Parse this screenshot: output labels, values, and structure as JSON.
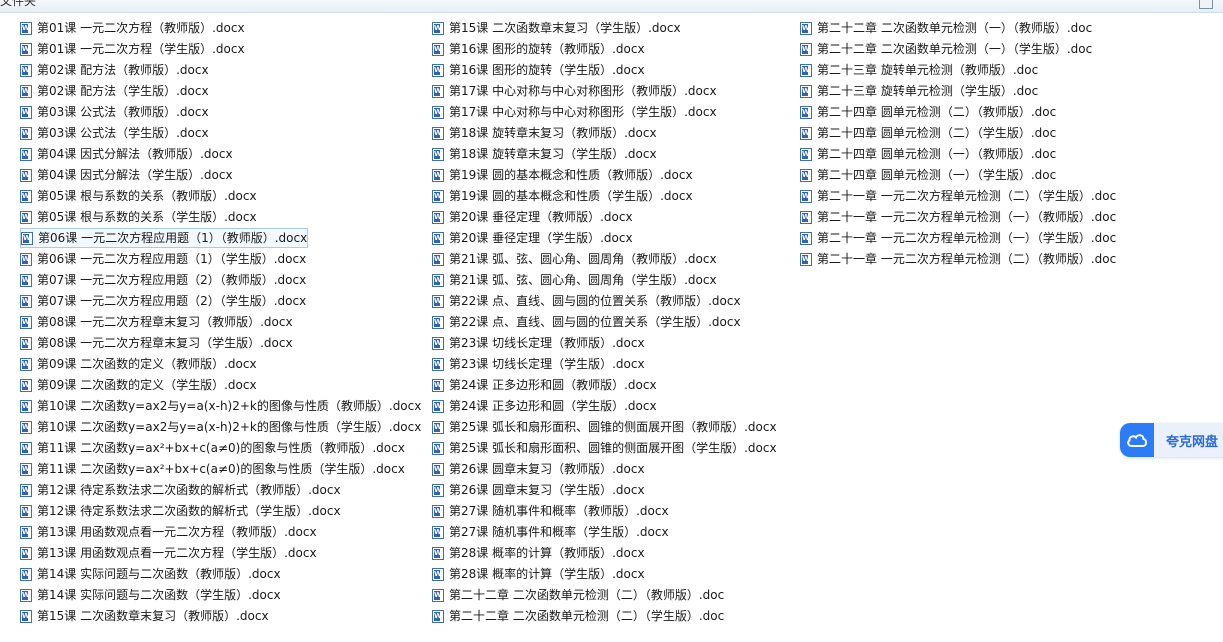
{
  "window": {
    "title": "文件夹"
  },
  "badge": {
    "label": "夸克网盘",
    "icon": "cloud-icon",
    "color": "#2b7cf6"
  },
  "columns": [
    [
      "第01课  一元二次方程（教师版）.docx",
      "第01课  一元二次方程（学生版）.docx",
      "第02课  配方法（教师版）.docx",
      "第02课  配方法（学生版）.docx",
      "第03课  公式法（教师版）.docx",
      "第03课  公式法（学生版）.docx",
      "第04课  因式分解法（教师版）.docx",
      "第04课  因式分解法（学生版）.docx",
      "第05课  根与系数的关系（教师版）.docx",
      "第05课  根与系数的关系（学生版）.docx",
      "第06课  一元二次方程应用题（1）（教师版）.docx",
      "第06课  一元二次方程应用题（1）（学生版）.docx",
      "第07课  一元二次方程应用题（2）（教师版）.docx",
      "第07课  一元二次方程应用题（2）（学生版）.docx",
      "第08课  一元二次方程章末复习（教师版）.docx",
      "第08课  一元二次方程章末复习（学生版）.docx",
      "第09课  二次函数的定义（教师版）.docx",
      "第09课  二次函数的定义（学生版）.docx",
      "第10课  二次函数y=ax2与y=a(x-h)2+k的图像与性质（教师版）.docx",
      "第10课  二次函数y=ax2与y=a(x-h)2+k的图像与性质（学生版）.docx",
      "第11课 二次函数y=ax²+bx+c(a≠0)的图象与性质（教师版）.docx",
      "第11课 二次函数y=ax²+bx+c(a≠0)的图象与性质（学生版）.docx",
      "第12课  待定系数法求二次函数的解析式（教师版）.docx",
      "第12课  待定系数法求二次函数的解析式（学生版）.docx",
      "第13课  用函数观点看一元二次方程（教师版）.docx",
      "第13课  用函数观点看一元二次方程（学生版）.docx",
      "第14课  实际问题与二次函数（教师版）.docx",
      "第14课  实际问题与二次函数（学生版）.docx",
      "第15课  二次函数章末复习（教师版）.docx"
    ],
    [
      "第15课  二次函数章末复习（学生版）.docx",
      "第16课  图形的旋转（教师版）.docx",
      "第16课  图形的旋转（学生版）.docx",
      "第17课  中心对称与中心对称图形（教师版）.docx",
      "第17课  中心对称与中心对称图形（学生版）.docx",
      "第18课  旋转章末复习（教师版）.docx",
      "第18课  旋转章末复习（学生版）.docx",
      "第19课  圆的基本概念和性质（教师版）.docx",
      "第19课  圆的基本概念和性质（学生版）.docx",
      "第20课  垂径定理（教师版）.docx",
      "第20课  垂径定理（学生版）.docx",
      "第21课  弧、弦、圆心角、圆周角（教师版）.docx",
      "第21课  弧、弦、圆心角、圆周角（学生版）.docx",
      "第22课  点、直线、圆与圆的位置关系（教师版）.docx",
      "第22课  点、直线、圆与圆的位置关系（学生版）.docx",
      "第23课  切线长定理（教师版）.docx",
      "第23课  切线长定理（学生版）.docx",
      "第24课  正多边形和圆（教师版）.docx",
      "第24课  正多边形和圆（学生版）.docx",
      "第25课  弧长和扇形面积、圆锥的侧面展开图（教师版）.docx",
      "第25课  弧长和扇形面积、圆锥的侧面展开图（学生版）.docx",
      "第26课  圆章末复习（教师版）.docx",
      "第26课  圆章末复习（学生版）.docx",
      "第27课 随机事件和概率（教师版）.docx",
      "第27课 随机事件和概率（学生版）.docx",
      "第28课  概率的计算（教师版）.docx",
      "第28课  概率的计算（学生版）.docx",
      "第二十二章   二次函数单元检测（二）（教师版）.doc",
      "第二十二章  二次函数单元检测（二）（学生版）.doc"
    ],
    [
      "第二十二章  二次函数单元检测（一）（教师版）.doc",
      "第二十二章  二次函数单元检测（一）（学生版）.doc",
      "第二十三章  旋转单元检测（教师版）.doc",
      "第二十三章  旋转单元检测（学生版）.doc",
      "第二十四章  圆单元检测（二）（教师版）.doc",
      "第二十四章  圆单元检测（二）（学生版）.doc",
      "第二十四章  圆单元检测（一）（教师版）.doc",
      "第二十四章  圆单元检测（一）（学生版）.doc",
      "第二十一章   一元二次方程单元检测（二）（学生版）.doc",
      "第二十一章   一元二次方程单元检测（一）（教师版）.doc",
      "第二十一章   一元二次方程单元检测（一）（学生版）.doc",
      "第二十一章  一元二次方程单元检测（二）（教师版）.doc"
    ]
  ]
}
